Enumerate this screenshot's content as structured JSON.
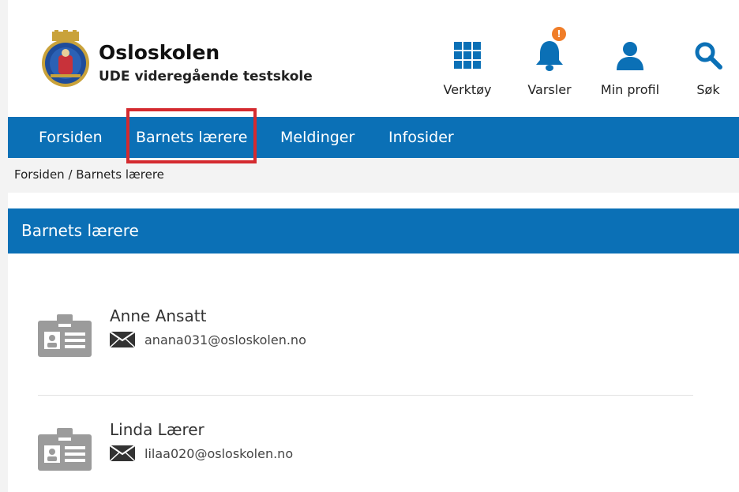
{
  "header": {
    "org_name": "Osloskolen",
    "school_name": "UDE videregående testskole",
    "tools": [
      {
        "label": "Verktøy",
        "icon": "grid-icon"
      },
      {
        "label": "Varsler",
        "icon": "bell-icon",
        "badge": "!"
      },
      {
        "label": "Min profil",
        "icon": "user-icon"
      },
      {
        "label": "Søk",
        "icon": "search-icon"
      }
    ]
  },
  "nav": {
    "items": [
      {
        "label": "Forsiden"
      },
      {
        "label": "Barnets lærere"
      },
      {
        "label": "Meldinger"
      },
      {
        "label": "Infosider"
      }
    ]
  },
  "breadcrumb": "Forsiden / Barnets lærere",
  "panel": {
    "title": "Barnets lærere",
    "teachers": [
      {
        "name": "Anne Ansatt",
        "email": "anana031@osloskolen.no"
      },
      {
        "name": "Linda Lærer",
        "email": "lilaa020@osloskolen.no"
      }
    ]
  },
  "colors": {
    "primary": "#0b70b6",
    "highlight": "#d42a2f",
    "badge": "#f07d28",
    "icon_gray": "#9b9b9b"
  }
}
